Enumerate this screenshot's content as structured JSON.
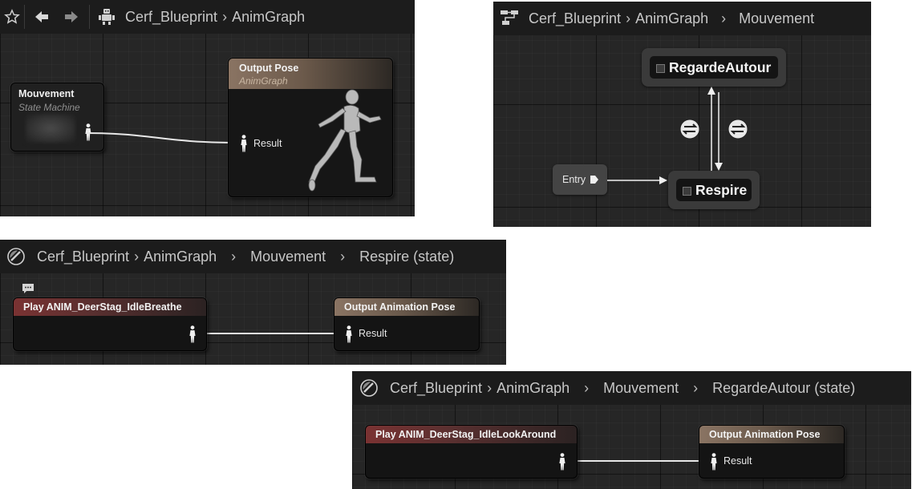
{
  "panel1": {
    "crumbs": [
      "Cerf_Blueprint",
      "AnimGraph"
    ],
    "state_machine_node": {
      "title": "Mouvement",
      "subtitle": "State Machine"
    },
    "output_node": {
      "title": "Output Pose",
      "subtitle": "AnimGraph",
      "pin": "Result"
    }
  },
  "panel2": {
    "crumbs": [
      "Cerf_Blueprint",
      "AnimGraph",
      "Mouvement"
    ],
    "states": {
      "top": "RegardeAutour",
      "bottom": "Respire"
    },
    "entry": "Entry"
  },
  "panel3": {
    "crumbs": [
      "Cerf_Blueprint",
      "AnimGraph",
      "Mouvement",
      "Respire (state)"
    ],
    "play_node": "Play ANIM_DeerStag_IdleBreathe",
    "output_node": {
      "title": "Output Animation Pose",
      "pin": "Result"
    }
  },
  "panel4": {
    "crumbs": [
      "Cerf_Blueprint",
      "AnimGraph",
      "Mouvement",
      "RegardeAutour (state)"
    ],
    "play_node": "Play ANIM_DeerStag_IdleLookAround",
    "output_node": {
      "title": "Output Animation Pose",
      "pin": "Result"
    }
  },
  "icons": {
    "favorite": "star-icon",
    "back": "back-arrow-icon",
    "forward": "forward-arrow-icon",
    "blueprint": "blueprint-icon",
    "state_machine": "state-machine-icon",
    "state": "state-icon",
    "person_pin": "person-pin-icon",
    "transition": "transition-icon",
    "comment": "comment-icon"
  },
  "colors": {
    "graph_bg": "#262626",
    "toolbar_bg": "#1c1c1c",
    "play_header": "#7a3232",
    "output_header": "#8a7463"
  }
}
